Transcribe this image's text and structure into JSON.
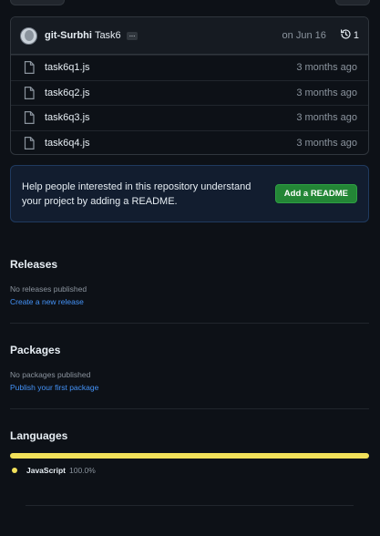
{
  "commit": {
    "author": "git-Surbhi",
    "message": "Task6",
    "ellipsis": "...",
    "date": "on Jun 16",
    "history_count": "1"
  },
  "files": [
    {
      "name": "task6q1.js",
      "age": "3 months ago"
    },
    {
      "name": "task6q2.js",
      "age": "3 months ago"
    },
    {
      "name": "task6q3.js",
      "age": "3 months ago"
    },
    {
      "name": "task6q4.js",
      "age": "3 months ago"
    }
  ],
  "readme": {
    "text": "Help people interested in this repository understand your project by adding a README.",
    "button_label": "Add a README"
  },
  "releases": {
    "title": "Releases",
    "subtitle": "No releases published",
    "link": "Create a new release"
  },
  "packages": {
    "title": "Packages",
    "subtitle": "No packages published",
    "link": "Publish your first package"
  },
  "languages": {
    "title": "Languages",
    "items": [
      {
        "name": "JavaScript",
        "percent": "100.0%",
        "color": "#f1e05a",
        "share": 1.0
      }
    ]
  }
}
